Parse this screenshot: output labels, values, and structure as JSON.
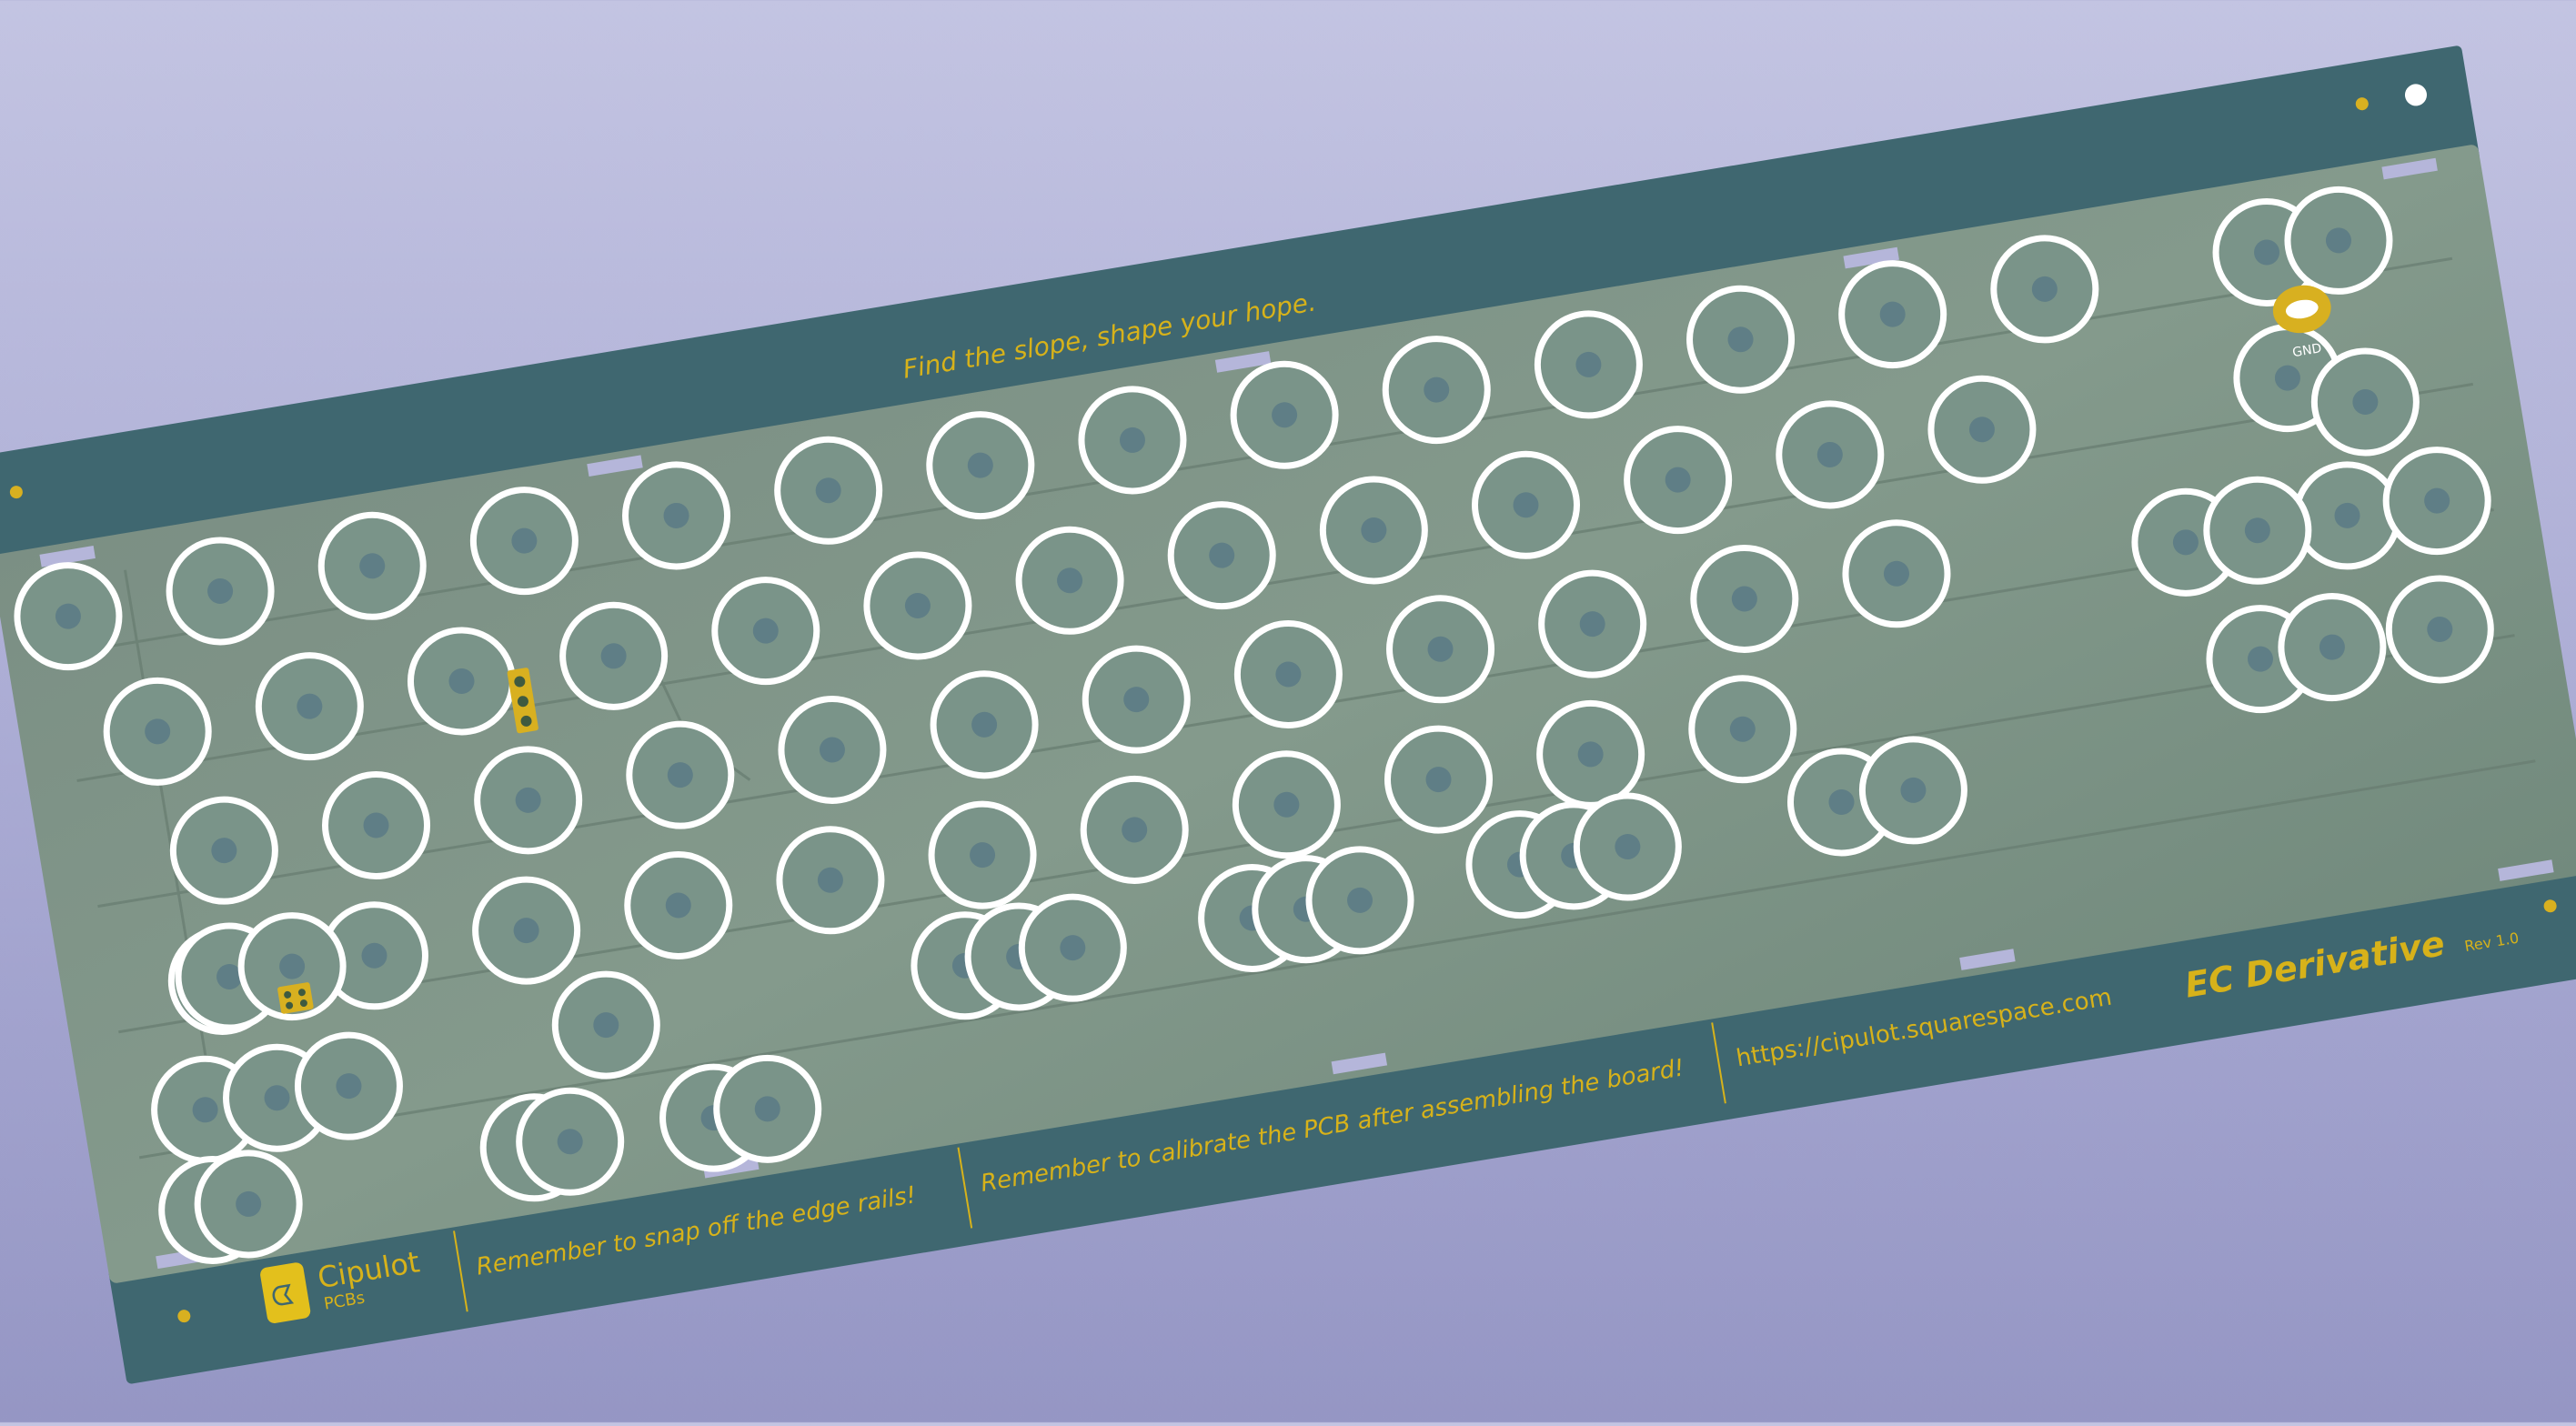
{
  "silkscreen": {
    "slogan": "Find the slope, shape your hope.",
    "gnd_label": "GND",
    "product_name": "EC Derivative",
    "revision": "Rev 1.0",
    "brand_name": "Cipulot",
    "brand_sub": "PCBs",
    "logo_glyph": "ᗧ",
    "note_rails": "Remember to snap off the edge rails!",
    "note_calibrate": "Remember to calibrate the PCB after assembling the board!",
    "website": "https://cipulot.squarespace.com"
  },
  "colors": {
    "background_top": "#c3c4e2",
    "background_bottom": "#9596c4",
    "rail": "#3f6770",
    "board_green": "#7e9184",
    "board_green_dark": "#6a7f73",
    "silk_yellow": "#d7b21a",
    "ring_white": "#ffffff",
    "pad_gold": "#d8b020",
    "pad_center": "#5f7e86"
  }
}
